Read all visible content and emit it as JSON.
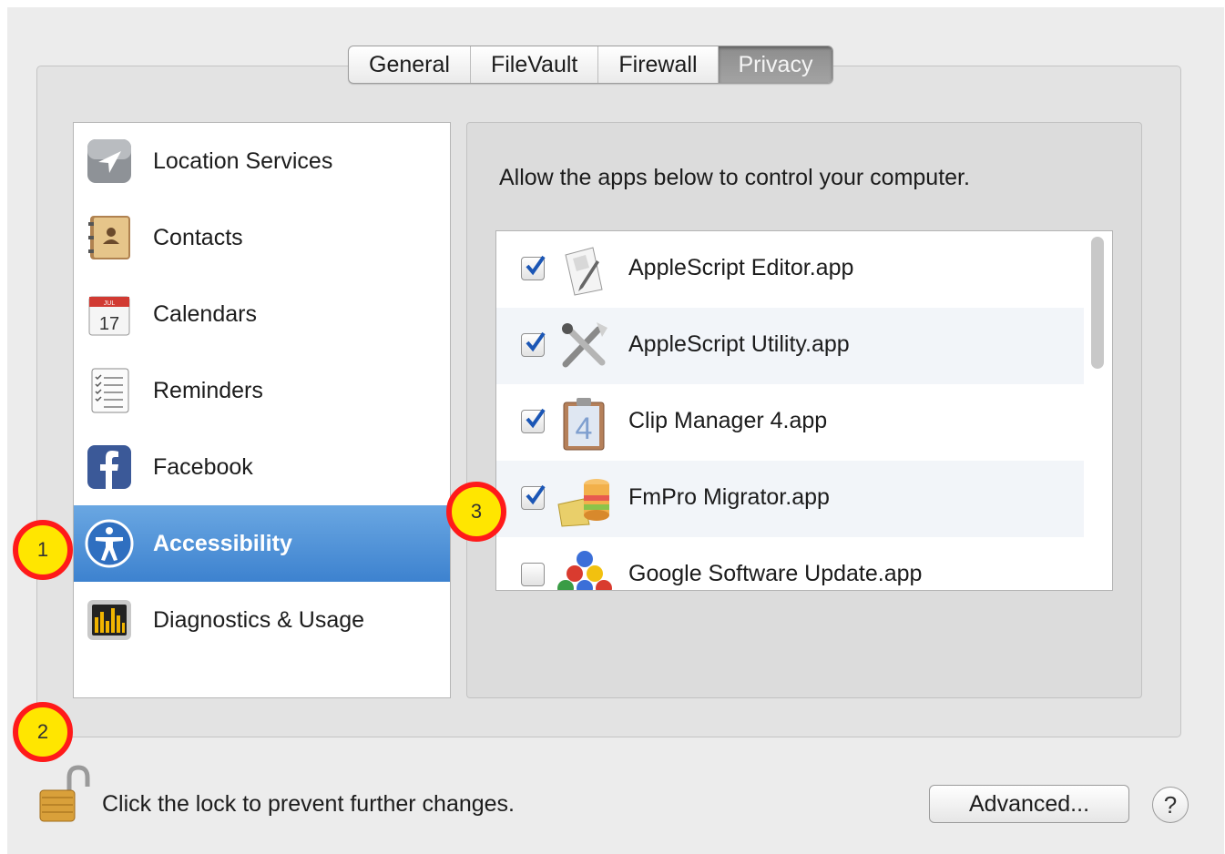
{
  "tabs": [
    {
      "label": "General",
      "active": false
    },
    {
      "label": "FileVault",
      "active": false
    },
    {
      "label": "Firewall",
      "active": false
    },
    {
      "label": "Privacy",
      "active": true
    }
  ],
  "sidebar": {
    "items": [
      {
        "label": "Location Services",
        "icon": "location-arrow-icon"
      },
      {
        "label": "Contacts",
        "icon": "contacts-book-icon"
      },
      {
        "label": "Calendars",
        "icon": "calendar-icon",
        "icon_text_top": "JUL",
        "icon_text": "17"
      },
      {
        "label": "Reminders",
        "icon": "reminders-list-icon"
      },
      {
        "label": "Facebook",
        "icon": "facebook-icon"
      },
      {
        "label": "Accessibility",
        "icon": "accessibility-icon",
        "selected": true
      },
      {
        "label": "Diagnostics & Usage",
        "icon": "diagnostics-icon"
      }
    ]
  },
  "detail": {
    "title": "Allow the apps below to control your computer.",
    "apps": [
      {
        "name": "AppleScript Editor.app",
        "checked": true,
        "icon": "applescript-editor-icon"
      },
      {
        "name": "AppleScript Utility.app",
        "checked": true,
        "icon": "applescript-utility-icon"
      },
      {
        "name": "Clip Manager 4.app",
        "checked": true,
        "icon": "clip-manager-icon",
        "icon_text": "4"
      },
      {
        "name": "FmPro Migrator.app",
        "checked": true,
        "icon": "fmpro-migrator-icon"
      },
      {
        "name": "Google Software Update.app",
        "checked": false,
        "icon": "google-software-update-icon"
      }
    ]
  },
  "footer": {
    "lock_text": "Click the lock to prevent further changes.",
    "advanced_label": "Advanced...",
    "help_label": "?"
  },
  "annotations": [
    "1",
    "2",
    "3"
  ],
  "colors": {
    "selection": "#3d82cf",
    "marker_fill": "#ffe600",
    "marker_ring": "#ff1a1a",
    "checkmark": "#1b56b5"
  }
}
